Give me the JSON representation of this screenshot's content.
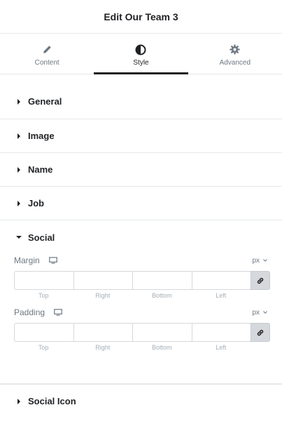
{
  "header": {
    "title": "Edit Our Team 3"
  },
  "tabs": [
    {
      "label": "Content",
      "icon": "pencil-icon",
      "active": false
    },
    {
      "label": "Style",
      "icon": "contrast-icon",
      "active": true
    },
    {
      "label": "Advanced",
      "icon": "gear-icon",
      "active": false
    }
  ],
  "sections": {
    "general": "General",
    "image": "Image",
    "name": "Name",
    "job": "Job",
    "social": "Social",
    "social_icon": "Social Icon"
  },
  "social": {
    "margin": {
      "label": "Margin",
      "unit": "px",
      "values": {
        "top": "",
        "right": "",
        "bottom": "",
        "left": ""
      },
      "labels": {
        "top": "Top",
        "right": "Right",
        "bottom": "Bottom",
        "left": "Left"
      }
    },
    "padding": {
      "label": "Padding",
      "unit": "px",
      "values": {
        "top": "",
        "right": "",
        "bottom": "",
        "left": ""
      },
      "labels": {
        "top": "Top",
        "right": "Right",
        "bottom": "Bottom",
        "left": "Left"
      }
    }
  },
  "colors": {
    "text": "#1f2124",
    "muted": "#6d7882",
    "border": "#e6e8ea",
    "link_bg": "#d5d8dc"
  }
}
